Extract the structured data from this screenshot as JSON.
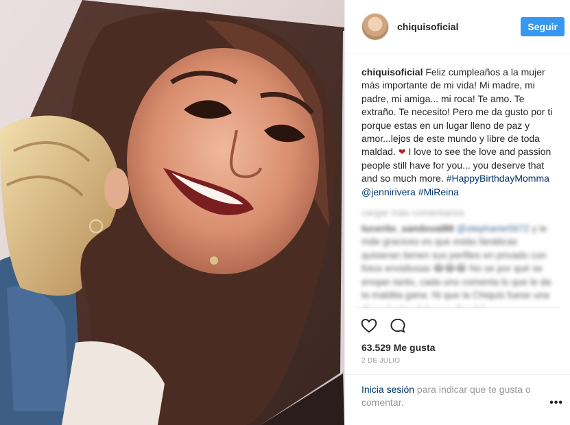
{
  "header": {
    "username": "chiquisoficial",
    "follow_label": "Seguir"
  },
  "caption": {
    "username": "chiquisoficial",
    "text_1": " Feliz cumpleaños a la mujer más importante de mi vida! Mi madre, mi padre, mi amiga... mi roca! Te amo. Te extraño. Te necesito! Pero me da gusto por ti porque estas en un lugar lleno de paz y amor...lejos de este mundo y libre de toda maldad. ",
    "heart": "❤",
    "text_2": " I love to see the love and passion people still have for you... you deserve that and so much more. ",
    "hashtag_1": "#HappyBirthdayMomma",
    "mention": "@jennirivera",
    "hashtag_2": "#MiReina"
  },
  "comments": {
    "load_more_label": "cargar más comentarios",
    "blurred_user": "lucerito_sandoval88",
    "blurred_mention": "@stephanie5672",
    "blurred_text": " y le mde gracioso es que estás fanáticas quisieran tienen sus perfiles en privado con fotos envidiosas 😂😂😂 No se por qué se enojan tanto, cada uno comenta lo que le da la maldita gana. Ni que la Chiquis fuese una diosa (entra dele eon dios lol"
  },
  "actions": {
    "like_icon": "heart-outline-icon",
    "comment_icon": "comment-bubble-icon"
  },
  "likes_text": "63.529 Me gusta",
  "date_text": "2 DE JULIO",
  "footer": {
    "login_link": "Inicia sesión",
    "login_text": " para indicar que te gusta o comentar.",
    "more_label": "•••"
  }
}
